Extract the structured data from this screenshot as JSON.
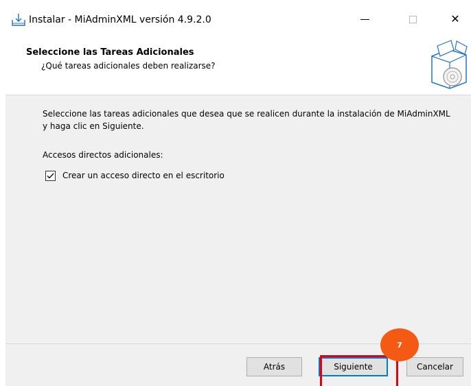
{
  "window": {
    "title": "Instalar - MiAdminXML versión 4.9.2.0",
    "icon": "download-install-icon",
    "controls": {
      "minimize": "minimize-icon",
      "maximize": "maximize-icon",
      "close": "close-icon",
      "close_glyph": "✕"
    }
  },
  "header": {
    "title": "Seleccione las Tareas Adicionales",
    "subtitle": "¿Qué tareas adicionales deben realizarse?",
    "icon": "software-box-disc-icon"
  },
  "content": {
    "description": "Seleccione las tareas adicionales que desea que se realicen durante la instalación de MiAdminXML y haga clic en Siguiente.",
    "group_label": "Accesos directos adicionales:",
    "tasks": [
      {
        "label": "Crear un acceso directo en el escritorio",
        "checked": true
      }
    ]
  },
  "buttons": {
    "back": "Atrás",
    "next": "Siguiente",
    "cancel": "Cancelar"
  },
  "annotation": {
    "step_number": "7",
    "badge_color": "#f45a14",
    "highlight_color": "#e3000f"
  },
  "colors": {
    "focus_border": "#0078d7",
    "dialog_background": "#f0f0f0"
  }
}
